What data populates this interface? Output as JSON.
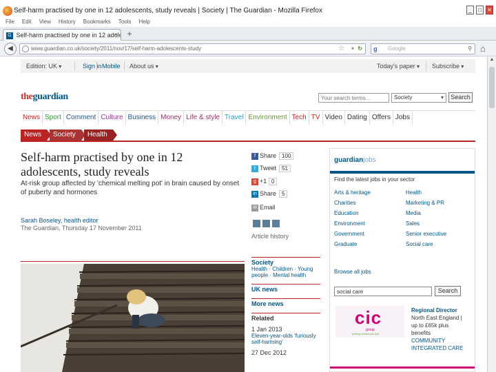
{
  "window": {
    "title": "Self-harm practised by one in 12 adolescents, study reveals | Society | The Guardian - Mozilla Firefox",
    "controls": [
      "_",
      "□",
      "✕"
    ]
  },
  "menu": [
    "File",
    "Edit",
    "View",
    "History",
    "Bookmarks",
    "Tools",
    "Help"
  ],
  "tab": {
    "label": "Self-harm practised by one in 12 adolescent...",
    "close": "×",
    "new": "+"
  },
  "address": {
    "url": "www.guardian.co.uk/society/2011/nov/17/self-harm-adolescents-study",
    "search_placeholder": "Google"
  },
  "edition_bar": {
    "edition": "Edition: UK",
    "sign_in": "Sign in",
    "mobile": "Mobile",
    "about_us": "About us",
    "todays_paper": "Today's paper",
    "subscribe": "Subscribe"
  },
  "logo": {
    "the": "the",
    "guardian": "guardian"
  },
  "site_search": {
    "placeholder": "Your search terms...",
    "section": "Society",
    "button": "Search"
  },
  "nav": [
    {
      "label": "News",
      "color": "#cc2222"
    },
    {
      "label": "Sport",
      "color": "#339933"
    },
    {
      "label": "Comment",
      "color": "#225588"
    },
    {
      "label": "Culture",
      "color": "#993399"
    },
    {
      "label": "Business",
      "color": "#225588"
    },
    {
      "label": "Money",
      "color": "#993366"
    },
    {
      "label": "Life & style",
      "color": "#993366"
    },
    {
      "label": "Travel",
      "color": "#3399cc"
    },
    {
      "label": "Environment",
      "color": "#669933"
    },
    {
      "label": "Tech",
      "color": "#cc2222"
    },
    {
      "label": "TV",
      "color": "#cc2222"
    },
    {
      "label": "Video",
      "color": "#333333"
    },
    {
      "label": "Dating",
      "color": "#333333"
    },
    {
      "label": "Offers",
      "color": "#333333"
    },
    {
      "label": "Jobs",
      "color": "#333333"
    }
  ],
  "breadcrumbs": [
    "News",
    "Society",
    "Health"
  ],
  "article": {
    "headline": "Self-harm practised by one in 12 adolescents, study reveals",
    "standfirst": "At-risk group affected by 'chemical melting pot' in brain caused by onset of puberty and hormones",
    "byline": "Sarah Boseley, health editor",
    "dateline": "The Guardian, Thursday 17 November 2011"
  },
  "share": {
    "facebook": {
      "label": "Share",
      "count": "100"
    },
    "twitter": {
      "label": "Tweet",
      "count": "51"
    },
    "gplus": {
      "label": "+1",
      "count": "0"
    },
    "linkedin": {
      "label": "Share",
      "count": "5"
    },
    "email": {
      "label": "Email"
    },
    "history": "Article history"
  },
  "related_col": {
    "section": "Society",
    "tags": "Health · Children · Young people · Mental health",
    "uk": "UK news",
    "more": "More news",
    "related": "Related",
    "date1": "1 Jan 2013",
    "note1": "Eleven-year-olds 'furiously self-harming'",
    "date2": "27 Dec 2012"
  },
  "jobs": {
    "logo": "guardian",
    "logo_suffix": "jobs",
    "find": "Find the latest jobs in your sector",
    "sectors": [
      [
        "Arts & heritage",
        "Health"
      ],
      [
        "Charities",
        "Marketing & PR"
      ],
      [
        "Education",
        "Media"
      ],
      [
        "Environment",
        "Sales"
      ],
      [
        "Government",
        "Senior executive"
      ],
      [
        "Graduate",
        "Social care"
      ]
    ],
    "browse": "Browse all jobs",
    "search_value": "social care",
    "search_button": "Search",
    "ad": {
      "logo_main": "cic",
      "logo_group": "group",
      "logo_tag": "putting individuals first",
      "title": "Regional Director",
      "location": "North East England |",
      "salary": "up to £65k plus",
      "benefits": "benefits",
      "org1": "COMMUNITY",
      "org2": "INTEGRATED CARE"
    }
  }
}
